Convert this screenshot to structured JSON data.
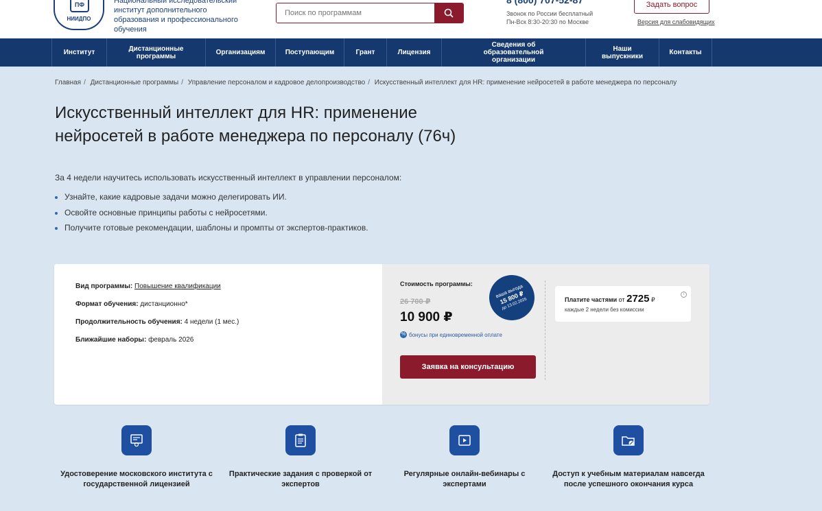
{
  "header": {
    "logo_text": "НИИДПО",
    "logo_mark": "ПФ",
    "org_name": "Национальный исследовательский институт дополнительного образования и профессионального обучения",
    "search_placeholder": "Поиск по программам",
    "phone": "8 (800) 707-52-87",
    "phone_info_1": "Звонок по России бесплатный",
    "phone_info_2": "Пн-Вск 8:30-20:30 по Москве",
    "ask_button": "Задать вопрос",
    "low_vision": "Версия для слабовидящих"
  },
  "nav": [
    {
      "label": "Институт"
    },
    {
      "label": "Дистанционные программы"
    },
    {
      "label": "Организациям"
    },
    {
      "label": "Поступающим"
    },
    {
      "label": "Грант"
    },
    {
      "label": "Лицензия"
    },
    {
      "label": "Сведения об образовательной организации"
    },
    {
      "label": "Наши выпускники"
    },
    {
      "label": "Контакты"
    }
  ],
  "breadcrumb": [
    "Главная",
    "Дистанционные программы",
    "Управление персоналом и кадровое делопроизводство",
    "Искусственный интеллект для HR: применение нейросетей в работе менеджера по персоналу"
  ],
  "title": "Искусственный интеллект для HR: применение нейросетей в работе менеджера по персоналу (76ч)",
  "intro": "За 4 недели научитесь использовать искусственный интеллект в управлении персоналом:",
  "bullets": [
    "Узнайте, какие кадровые задачи можно делегировать ИИ.",
    "Освойте основные принципы работы с нейросетями.",
    "Получите готовые рекомендации, шаблоны и промпты от экспертов-практиков."
  ],
  "card": {
    "program_type_label": "Вид программы:",
    "program_type_value": "Повышение квалификации",
    "format_label": "Формат обучения:",
    "format_value": "дистанционно*",
    "duration_label": "Продолжительность обучения:",
    "duration_value": "4 недели (1 мес.)",
    "next_label": "Ближайшие наборы:",
    "next_value": "февраль 2026",
    "cost_label": "Стоимость программы:",
    "old_price": "26 700 ₽",
    "new_price": "10 900 ₽",
    "bonus": "бонусы при единовременной оплате",
    "badge_line1": "ваша выгода",
    "badge_line2": "15 800 ₽",
    "badge_line3": "до 13.02.2026",
    "cta": "Заявка на консультацию",
    "installment_prefix": "Платите частями",
    "installment_from": "от",
    "installment_amount": "2725",
    "installment_currency": "₽",
    "installment_sub": "каждые 2 недели без комиссии"
  },
  "features": [
    {
      "icon": "certificate-icon",
      "text": "Удостоверение московского института с государственной лицензией"
    },
    {
      "icon": "clipboard-icon",
      "text": "Практические задания с проверкой от экспертов"
    },
    {
      "icon": "video-icon",
      "text": "Регулярные онлайн-вебинары с экспертами"
    },
    {
      "icon": "folder-access-icon",
      "text": "Доступ к учебным материалам навсегда после успешного окончания курса"
    }
  ]
}
